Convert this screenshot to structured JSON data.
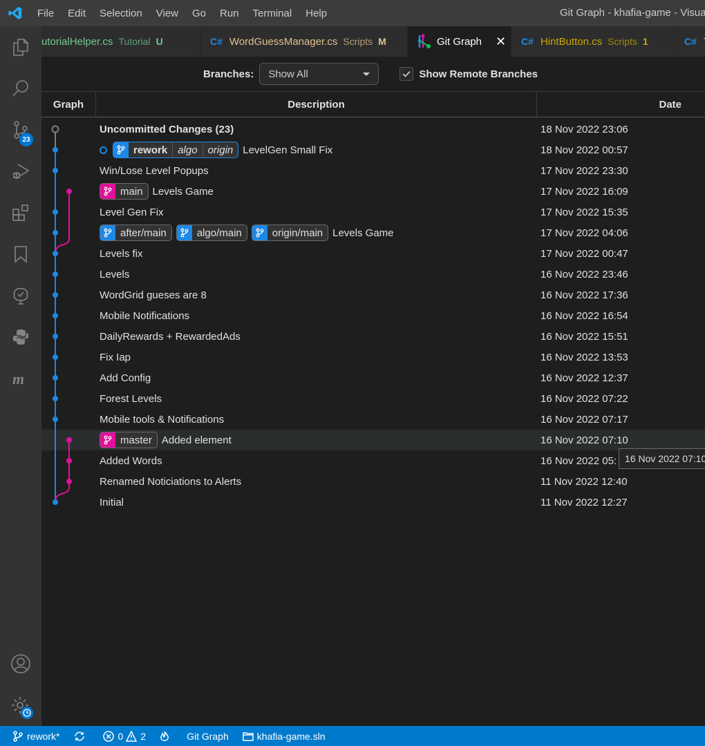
{
  "titlebar": {
    "menu": [
      "File",
      "Edit",
      "Selection",
      "View",
      "Go",
      "Run",
      "Terminal",
      "Help"
    ],
    "window_title": "Git Graph - khafia-game - Visual Studio Code"
  },
  "activitybar": {
    "items": [
      "explorer-icon",
      "search-icon",
      "source-control-icon",
      "run-debug-icon",
      "extensions-icon",
      "bookmarks-icon",
      "git-tree-icon",
      "python-icon",
      "m-extension-icon"
    ],
    "source_control_badge": "23",
    "bottom": [
      "account-icon",
      "manage-gear-icon"
    ]
  },
  "tabs": [
    {
      "name": "TutorialHelper.cs",
      "label": "utorialHelper.cs",
      "dir": "Tutorial",
      "status": "U",
      "color": "#73c991",
      "lang": ""
    },
    {
      "name": "WordGuessManager.cs",
      "label": "WordGuessManager.cs",
      "dir": "Scripts",
      "status": "M",
      "color": "#e2c08d",
      "lang": "C#"
    },
    {
      "name": "Git Graph",
      "label": "Git Graph",
      "active": true
    },
    {
      "name": "HintButton.cs",
      "label": "HintButton.cs",
      "dir": "Scripts",
      "status": "1",
      "color": "#cca700",
      "lang": "C#"
    },
    {
      "name": "T",
      "label": "T",
      "lang": "C#"
    }
  ],
  "controls": {
    "branches_label": "Branches:",
    "branches_value": "Show All",
    "show_remote_label": "Show Remote Branches",
    "show_remote_checked": true
  },
  "table": {
    "headers": {
      "graph": "Graph",
      "description": "Description",
      "date": "Date"
    },
    "rows": [
      {
        "desc": "Uncommitted Changes (23)",
        "date": "18 Nov 2022 23:06",
        "bold": true,
        "refs": []
      },
      {
        "desc": "LevelGen Small Fix",
        "date": "18 Nov 2022 00:57",
        "head": true,
        "refs": [
          {
            "name": "rework",
            "color": "#1e88e5",
            "remotes": [
              "algo",
              "origin"
            ],
            "bold": true
          }
        ]
      },
      {
        "desc": "Win/Lose Level Popups",
        "date": "17 Nov 2022 23:30",
        "refs": []
      },
      {
        "desc": "Levels Game",
        "date": "17 Nov 2022 16:09",
        "refs": [
          {
            "name": "main",
            "color": "#e0109a"
          }
        ]
      },
      {
        "desc": "Level Gen Fix",
        "date": "17 Nov 2022 15:35",
        "refs": []
      },
      {
        "desc": "Levels Game",
        "date": "17 Nov 2022 04:06",
        "refs": [
          {
            "name": "after/main",
            "color": "#1e88e5"
          },
          {
            "name": "algo/main",
            "color": "#1e88e5"
          },
          {
            "name": "origin/main",
            "color": "#1e88e5"
          }
        ]
      },
      {
        "desc": "Levels fix",
        "date": "17 Nov 2022 00:47",
        "refs": []
      },
      {
        "desc": "Levels",
        "date": "16 Nov 2022 23:46",
        "refs": []
      },
      {
        "desc": "WordGrid gueses are 8",
        "date": "16 Nov 2022 17:36",
        "refs": []
      },
      {
        "desc": "Mobile Notifications",
        "date": "16 Nov 2022 16:54",
        "refs": []
      },
      {
        "desc": "DailyRewards + RewardedAds",
        "date": "16 Nov 2022 15:51",
        "refs": []
      },
      {
        "desc": "Fix Iap",
        "date": "16 Nov 2022 13:53",
        "refs": []
      },
      {
        "desc": "Add Config",
        "date": "16 Nov 2022 12:37",
        "refs": []
      },
      {
        "desc": "Forest Levels",
        "date": "16 Nov 2022 07:22",
        "refs": []
      },
      {
        "desc": "Mobile tools & Notifications",
        "date": "16 Nov 2022 07:17",
        "refs": []
      },
      {
        "desc": "Added element",
        "date": "16 Nov 2022 07:10",
        "hover": true,
        "refs": [
          {
            "name": "master",
            "color": "#e0109a"
          }
        ]
      },
      {
        "desc": "Added Words",
        "date": "16 Nov 2022 05:",
        "refs": []
      },
      {
        "desc": "Renamed Noticiations to Alerts",
        "date": "11 Nov 2022 12:40",
        "refs": []
      },
      {
        "desc": "Initial",
        "date": "11 Nov 2022 12:27",
        "refs": []
      }
    ]
  },
  "graph": {
    "colors": {
      "uncommitted": "#808080",
      "lane0": "#1e88e5",
      "lane1": "#e0109a"
    },
    "lanes": [
      {
        "lane": 0,
        "color": "lane0",
        "from_row": 1,
        "to_row": 18
      },
      {
        "lane": 1,
        "color": "lane1",
        "from_row": 3,
        "to_row": 5,
        "merge_into_lane": 0,
        "merge_row": 6
      },
      {
        "lane": 1,
        "color": "lane1",
        "from_row": 15,
        "to_row": 17,
        "merge_into_lane": 0,
        "merge_row": 18
      }
    ],
    "nodes": [
      {
        "row": 0,
        "lane": 0,
        "color": "uncommitted",
        "hollow": true
      },
      {
        "row": 1,
        "lane": 0,
        "color": "lane0"
      },
      {
        "row": 2,
        "lane": 0,
        "color": "lane0"
      },
      {
        "row": 3,
        "lane": 1,
        "color": "lane1"
      },
      {
        "row": 4,
        "lane": 0,
        "color": "lane0"
      },
      {
        "row": 5,
        "lane": 0,
        "color": "lane0"
      },
      {
        "row": 6,
        "lane": 0,
        "color": "lane0"
      },
      {
        "row": 7,
        "lane": 0,
        "color": "lane0"
      },
      {
        "row": 8,
        "lane": 0,
        "color": "lane0"
      },
      {
        "row": 9,
        "lane": 0,
        "color": "lane0"
      },
      {
        "row": 10,
        "lane": 0,
        "color": "lane0"
      },
      {
        "row": 11,
        "lane": 0,
        "color": "lane0"
      },
      {
        "row": 12,
        "lane": 0,
        "color": "lane0"
      },
      {
        "row": 13,
        "lane": 0,
        "color": "lane0"
      },
      {
        "row": 14,
        "lane": 0,
        "color": "lane0"
      },
      {
        "row": 15,
        "lane": 1,
        "color": "lane1"
      },
      {
        "row": 16,
        "lane": 1,
        "color": "lane1"
      },
      {
        "row": 17,
        "lane": 1,
        "color": "lane1"
      },
      {
        "row": 18,
        "lane": 0,
        "color": "lane0"
      }
    ]
  },
  "tooltip": "16 Nov 2022 07:10",
  "statusbar": {
    "branch": "rework*",
    "errors": "0",
    "warnings": "2",
    "git_graph": "Git Graph",
    "solution": "khafia-game.sln"
  }
}
